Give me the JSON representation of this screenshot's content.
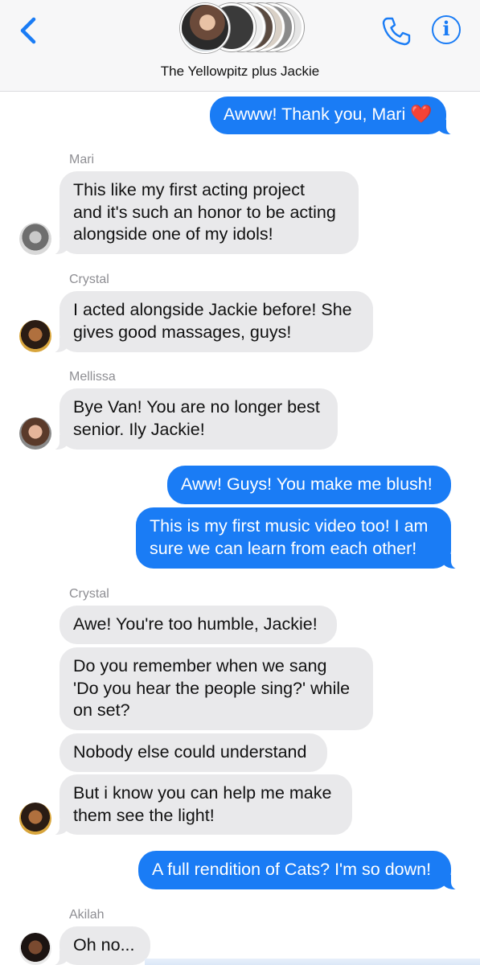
{
  "header": {
    "title": "The Yellowpitz plus Jackie",
    "back_icon": "chevron-left-icon",
    "call_icon": "phone-icon",
    "info_icon": "info-icon",
    "info_glyph": "i",
    "accent_color": "#1a7cf5"
  },
  "messages": [
    {
      "from": "me",
      "text": "Awww! Thank you, Mari",
      "emoji": "❤️"
    },
    {
      "sender": "Mari",
      "text": [
        "This like my first acting project",
        "and it's such an honor to be acting",
        "alongside one of my idols!"
      ]
    },
    {
      "sender": "Crystal",
      "text": [
        "I acted alongside Jackie before! She",
        "gives good massages, guys!"
      ]
    },
    {
      "sender": "Mellissa",
      "text": [
        "Bye Van! You are no longer best",
        "senior. Ily Jackie!"
      ]
    },
    {
      "from": "me",
      "text": "Aww! Guys! You make me blush!"
    },
    {
      "from": "me",
      "text": [
        "This is my first music video too! I am",
        "sure we can learn from each other!"
      ]
    },
    {
      "sender": "Crystal",
      "text": "Awe! You're too humble, Jackie!"
    },
    {
      "sender": "Crystal",
      "text": [
        "Do you remember when we sang",
        "'Do you hear the people sing?' while",
        "on set?"
      ]
    },
    {
      "sender": "Crystal",
      "text": "Nobody else could understand"
    },
    {
      "sender": "Crystal",
      "text": [
        "But i know you can help me make",
        "them see the light!"
      ]
    },
    {
      "from": "me",
      "text": "A full rendition of Cats? I'm so down!"
    },
    {
      "sender": "Akilah",
      "text": "Oh no..."
    }
  ],
  "senders": {
    "mari": "Mari",
    "crystal": "Crystal",
    "mellissa": "Mellissa",
    "crystal2": "Crystal",
    "akilah": "Akilah"
  },
  "bubbles": {
    "m1": "Awww! Thank you, Mari",
    "m1_emoji": "❤️",
    "m2_l1": "This like my first acting project",
    "m2_l2": "and it's such an honor to be acting",
    "m2_l3": "alongside one of my idols!",
    "m3_l1": "I acted alongside Jackie before! She",
    "m3_l2": "gives good massages, guys!",
    "m4_l1": "Bye Van! You are no longer best",
    "m4_l2": "senior. Ily Jackie!",
    "m5": "Aww! Guys! You make me blush!",
    "m6_l1": "This is my first music video too! I am",
    "m6_l2": "sure we can learn from each other!",
    "m7": "Awe! You're too humble, Jackie!",
    "m8_l1": "Do you remember when we sang",
    "m8_l2": "'Do you hear the people sing?' while",
    "m8_l3": "on set?",
    "m9": "Nobody else could understand",
    "m10_l1": "But i know you can help me make",
    "m10_l2": "them see the light!",
    "m11": "A full rendition of Cats? I'm so down!",
    "m12": "Oh no..."
  },
  "colors": {
    "outgoing": "#1a7cf5",
    "incoming": "#e9e9eb",
    "sender_label": "#8e8e93"
  }
}
